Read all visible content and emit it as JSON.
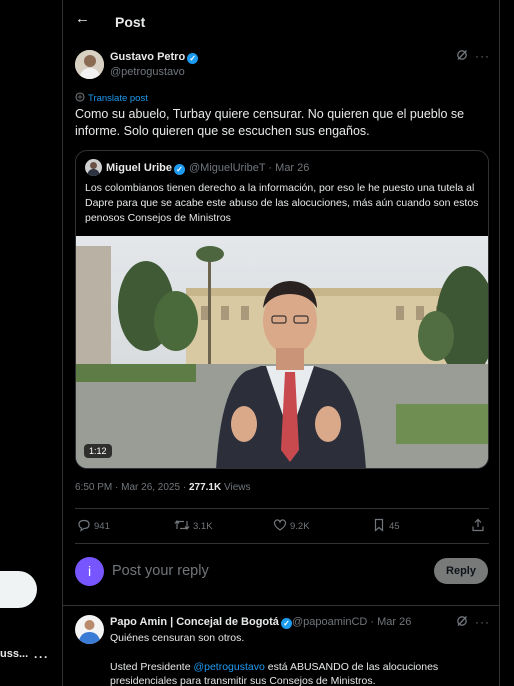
{
  "sidebar": {
    "truncated_name": "uss...",
    "more": "···"
  },
  "header": {
    "back": "←",
    "title": "Post"
  },
  "post": {
    "author": "Gustavo Petro",
    "handle": "@petrogustavo",
    "translate": "Translate post",
    "text": "Como su abuelo,  Turbay quiere censurar. No quieren que el pueblo se informe. Solo quieren que se escuchen sus engaños.",
    "time": "6:50 PM · Mar 26, 2025 · ",
    "views_count": "277.1K",
    "views_label": " Views",
    "more": "···"
  },
  "quote": {
    "author": "Miguel Uribe",
    "handle_date": "@MiguelUribeT · Mar 26",
    "text": "Los colombianos tienen derecho a la información, por eso le he puesto una tutela al Dapre para que se acabe este abuso de las alocuciones, más aún cuando son estos penosos Consejos de Ministros",
    "video_duration": "1:12"
  },
  "actions": {
    "replies": "941",
    "reposts": "3.1K",
    "likes": "9.2K",
    "bookmarks": "45"
  },
  "composer": {
    "avatar_letter": "i",
    "placeholder": "Post your reply",
    "button": "Reply"
  },
  "reply": {
    "author": "Papo Amin | Concejal de Bogotá",
    "handle_date": "@papoaminCD · Mar 26",
    "line1": "Quiénes censuran son otros.",
    "line2_pre": "Usted Presidente ",
    "line2_mention": "@petrogustavo",
    "line2_post": " está ABUSANDO de las alocuciones",
    "line3": "presidenciales para transmitir sus Consejos de Ministros.",
    "more": "···"
  },
  "colors": {
    "accent": "#1d9bf0",
    "background": "#000000",
    "border": "#2f3336",
    "muted": "#71767b",
    "reply_avatar": "#7856ff"
  }
}
